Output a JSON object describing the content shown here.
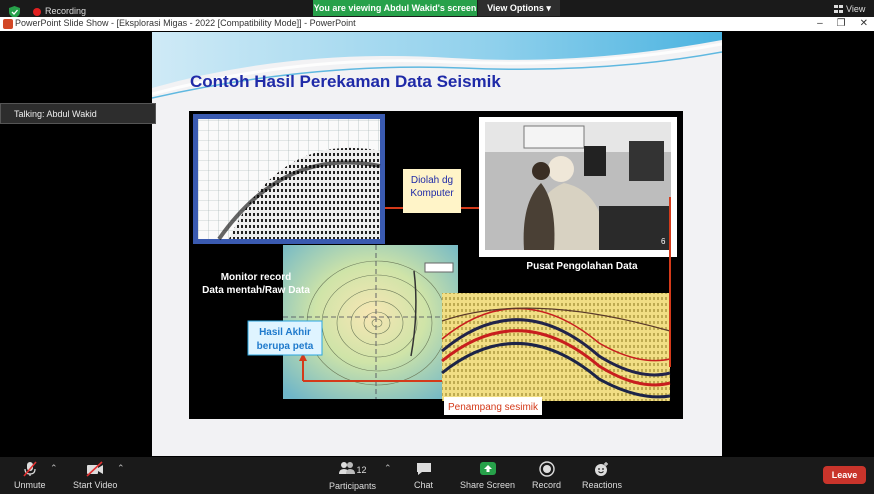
{
  "recording": {
    "label": "Recording"
  },
  "banner": {
    "viewing": "You are viewing Abdul Wakid's screen",
    "view_options": "View Options ▾",
    "view": "View"
  },
  "ppt": {
    "window_title": "PowerPoint Slide Show - [Eksplorasi Migas - 2022 [Compatibility Mode]] - PowerPoint"
  },
  "talking": {
    "label": "Talking: Abdul Wakid"
  },
  "slide": {
    "title": "Contoh Hasil Perekaman Data Seismik",
    "diolah": "Diolah dg\nKomputer",
    "monitor_caption": "Monitor record\nData mentah/Raw Data",
    "pusat_caption": "Pusat Pengolahan Data",
    "hasil_caption": "Hasil Akhir\nberupa peta",
    "penampang_caption": "Penampang sesimik",
    "photo_number": "6"
  },
  "toolbar": {
    "unmute": "Unmute",
    "start_video": "Start Video",
    "participants": "Participants",
    "participant_count": "12",
    "chat": "Chat",
    "share_screen": "Share Screen",
    "record": "Record",
    "reactions": "Reactions",
    "leave": "Leave"
  },
  "colors": {
    "accent_green": "#27a14a",
    "leave_red": "#c9342b",
    "slide_title_blue": "#1f2aa8"
  }
}
